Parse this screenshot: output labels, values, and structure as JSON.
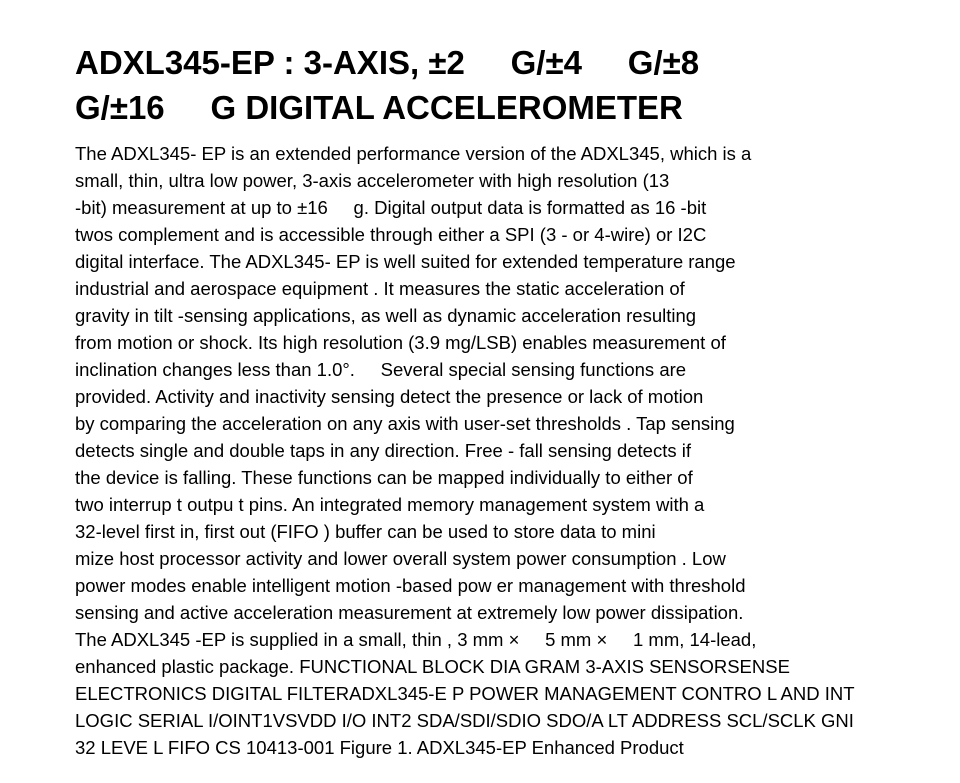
{
  "title_lines": [
    "ADXL345-EP : 3-AXIS, ±2     G/±4     G/±8",
    "G/±16     G DIGITAL ACCELEROMETER"
  ],
  "body_lines": [
    "The ADXL345- EP is an extended performance version of the ADXL345, which is a",
    "small, thin, ultra low power, 3-axis accelerometer with high resolution (13",
    "-bit) measurement at up to ±16     g. Digital output data is formatted as 16 -bit",
    "twos complement and is accessible through either a SPI (3 - or 4-wire) or I2C",
    "digital interface. The ADXL345- EP is well suited for extended temperature range",
    "industrial and aerospace equipment . It measures the static acceleration of",
    "gravity in tilt -sensing applications, as well as dynamic acceleration resulting",
    "from motion or shock. Its high resolution (3.9 mg/LSB) enables measurement of",
    "inclination changes less than 1.0°.     Several special sensing functions are",
    "provided. Activity and inactivity sensing detect the presence or lack of motion",
    "by comparing the acceleration on any axis with user-set thresholds . Tap sensing",
    "detects single and double taps in any direction. Free - fall sensing detects if",
    "the device is falling. These functions can be mapped individually to either of",
    "two interrup t outpu t pins. An integrated memory management system with a",
    "32-level first in, first out (FIFO ) buffer can be used to store data to mini",
    "mize host processor activity and lower overall system power consumption . Low",
    "power modes enable intelligent motion -based pow er management with threshold",
    "sensing and active acceleration measurement at extremely low power dissipation.",
    "The ADXL345 -EP is supplied in a small, thin , 3 mm ×     5 mm ×     1 mm, 14-lead,",
    "enhanced plastic package. FUNCTIONAL BLOCK DIA GRAM 3-AXIS SENSORSENSE",
    "ELECTRONICS DIGITAL FILTERADXL345-E P POWER MANAGEMENT CONTRO L AND INT",
    "LOGIC SERIAL I/OINT1VSVDD I/O INT2 SDA/SDI/SDIO SDO/A LT ADDRESS SCL/SCLK GNI",
    "32 LEVE L FIFO CS 10413-001 Figure 1. ADXL345-EP Enhanced Product"
  ]
}
